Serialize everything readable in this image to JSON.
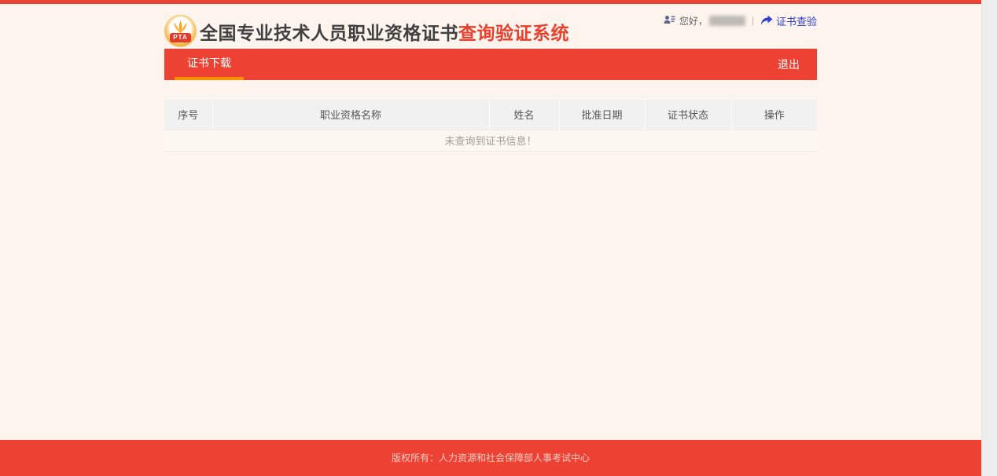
{
  "brand": {
    "logo_text": "PTA",
    "title_main": "全国专业技术人员职业资格证书",
    "title_accent": "查询验证系统"
  },
  "user_bar": {
    "greeting": "您好，",
    "separator": "|",
    "verify_link": "证书查验"
  },
  "nav": {
    "tab_download": "证书下载",
    "logout": "退出"
  },
  "table": {
    "headers": [
      "序号",
      "职业资格名称",
      "姓名",
      "批准日期",
      "证书状态",
      "操作"
    ],
    "empty_message": "未查询到证书信息！"
  },
  "footer": {
    "copyright": "版权所有：人力资源和社会保障部人事考试中心"
  },
  "colors": {
    "primary_red": "#ed4134",
    "tab_underline_orange": "#ff9000",
    "link_blue": "#2e41cf",
    "page_background": "#fdf4ee",
    "table_header_gray": "#f1f1f1"
  }
}
